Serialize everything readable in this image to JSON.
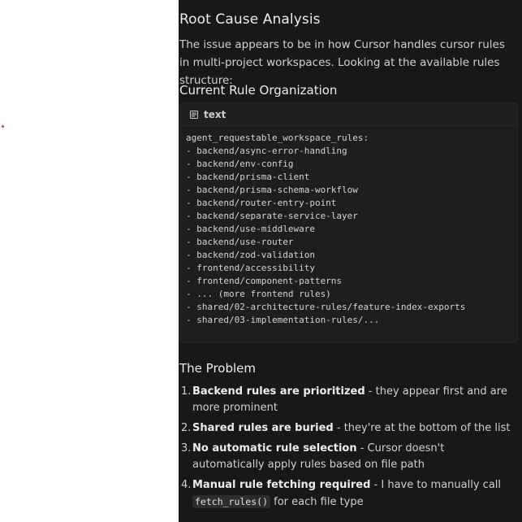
{
  "section_title": "Root Cause Analysis",
  "intro": "The issue appears to be in how Cursor handles cursor rules in multi-project workspaces. Looking at the available rules structure:",
  "subsection_title": "Current Rule Organization",
  "code_block": {
    "language": "text",
    "language_icon": "document-lines-icon",
    "lines": [
      "agent_requestable_workspace_rules:",
      "- backend/async-error-handling",
      "- backend/env-config",
      "- backend/prisma-client",
      "- backend/prisma-schema-workflow",
      "- backend/router-entry-point",
      "- backend/separate-service-layer",
      "- backend/use-middleware",
      "- backend/use-router",
      "- backend/zod-validation",
      "- frontend/accessibility",
      "- frontend/component-patterns",
      "- ... (more frontend rules)",
      "- shared/02-architecture-rules/feature-index-exports",
      "- shared/03-implementation-rules/..."
    ]
  },
  "problem_title": "The Problem",
  "problems": [
    {
      "num": "1.",
      "bold": "Backend rules are prioritized",
      "rest": " - they appear first and are more prominent"
    },
    {
      "num": "2.",
      "bold": "Shared rules are buried",
      "rest": " - they're at the bottom of the list"
    },
    {
      "num": "3.",
      "bold": "No automatic rule selection",
      "rest": " - Cursor doesn't automatically apply rules based on file path"
    },
    {
      "num": "4.",
      "bold": "Manual rule fetching required",
      "rest": " - I have to manually call ",
      "code": "fetch_rules()",
      "tail": " for each file type"
    }
  ],
  "colors": {
    "panel_bg": "#181818",
    "code_bg": "#1e1e1e",
    "text": "#d0d0d0",
    "heading": "#ececec",
    "dot": "#e0325f"
  }
}
